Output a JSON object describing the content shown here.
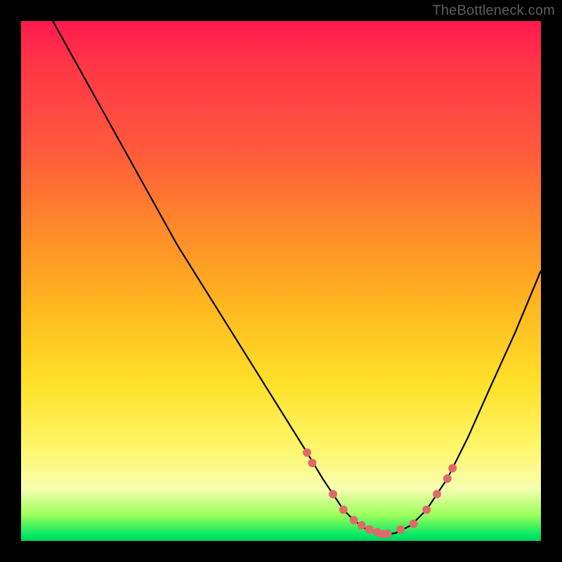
{
  "watermark": "TheBottleneck.com",
  "colors": {
    "background": "#000000",
    "gradient_top": "#ff1a4d",
    "gradient_mid1": "#ff8a2a",
    "gradient_mid2": "#ffe22a",
    "gradient_bottom": "#00d060",
    "curve_stroke": "#000000",
    "marker_fill": "#e06a6a",
    "watermark_text": "#5c5c5c"
  },
  "chart_data": {
    "type": "line",
    "title": "",
    "xlabel": "",
    "ylabel": "",
    "xlim": [
      0,
      100
    ],
    "ylim": [
      0,
      100
    ],
    "grid": false,
    "legend": false,
    "series": [
      {
        "name": "bottleneck-curve",
        "x": [
          0,
          5,
          10,
          15,
          20,
          25,
          30,
          35,
          40,
          45,
          50,
          55,
          58,
          60,
          62,
          64,
          66,
          68,
          70,
          72,
          75,
          78,
          82,
          86,
          90,
          95,
          100
        ],
        "values": [
          110,
          102,
          93,
          84,
          75,
          66,
          57,
          49,
          41,
          33,
          25,
          17,
          12,
          9,
          6,
          4,
          2.5,
          1.7,
          1.2,
          1.5,
          3,
          6,
          12,
          20,
          29,
          40,
          52
        ]
      }
    ],
    "markers": {
      "name": "highlight-points",
      "x": [
        55,
        56,
        60,
        62,
        64,
        65.5,
        67,
        68.5,
        69.5,
        70.5,
        73,
        75.5,
        78,
        80,
        82,
        83
      ],
      "values": [
        17,
        15,
        9,
        6,
        4,
        3,
        2.2,
        1.7,
        1.3,
        1.4,
        2.2,
        3.3,
        6,
        9,
        12,
        14
      ]
    }
  }
}
